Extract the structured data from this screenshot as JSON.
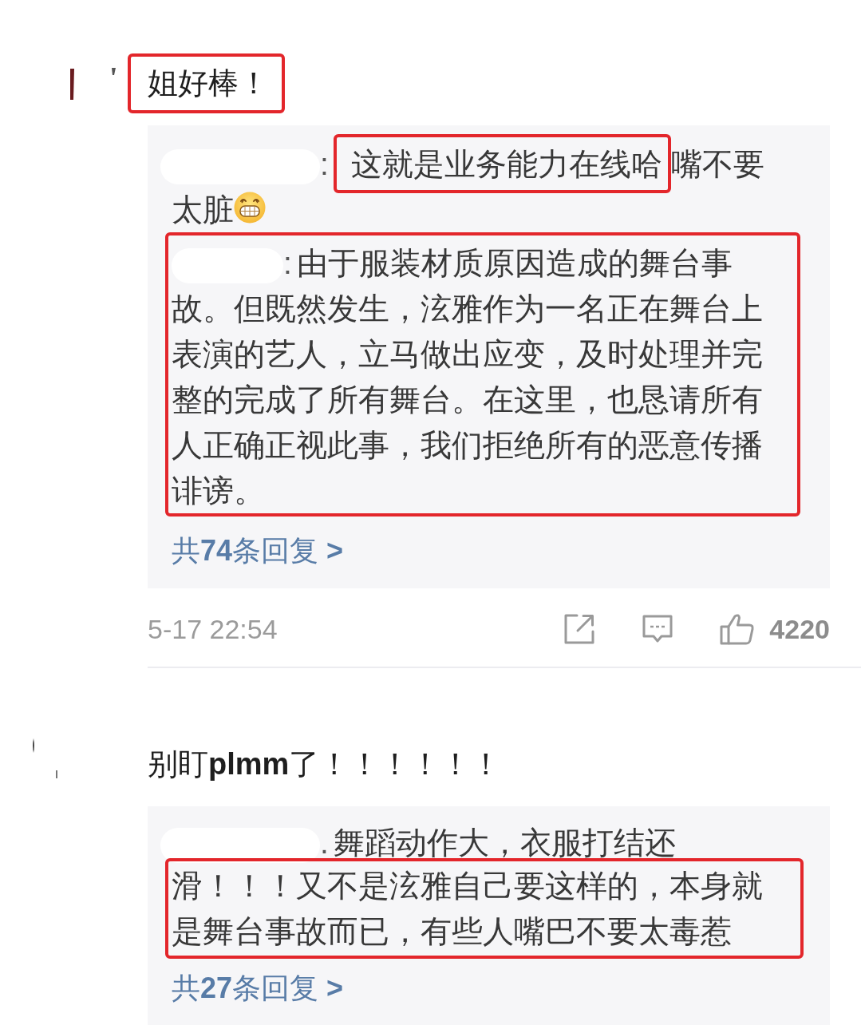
{
  "comments": [
    {
      "author_redacted": true,
      "text": "姐好棒！",
      "highlighted": true,
      "replies": [
        {
          "author_redacted": true,
          "separator": ":",
          "highlighted": false,
          "segments": [
            {
              "kind": "text",
              "text": "这就是业务能力在线哈",
              "highlighted": true
            },
            {
              "kind": "text",
              "text": "嘴不要太脏",
              "highlighted": false
            },
            {
              "kind": "emoji"
            }
          ]
        },
        {
          "author_redacted": true,
          "separator": ":",
          "highlighted": true,
          "segments": [
            {
              "kind": "text",
              "text": "由于服装材质原因造成的舞台事故。但既然发生，泫雅作为一名正在舞台上表演的艺人，立马做出应变，及时处理并完整的完成了所有舞台。在这里，也恳请所有人正确正视此事，我们拒绝所有的恶意传播诽谤。",
              "highlighted": false
            }
          ]
        }
      ],
      "reply_count_link": "共**74**条回复 **>**",
      "time": "5-17 22:54",
      "likes": "4220"
    },
    {
      "author_redacted": true,
      "text": "别盯**plmm**了！！！！！！",
      "highlighted": false,
      "replies": [
        {
          "author_redacted": true,
          "separator": ".",
          "highlighted": false,
          "segments": [
            {
              "kind": "text",
              "text": "舞蹈动作大，衣服打结还",
              "highlighted": false
            },
            {
              "kind": "text",
              "text": "滑！！！又不是泫雅自己要这样的，本身就是舞台事故而已，有些人嘴巴不要太毒惹",
              "highlighted": true
            }
          ]
        }
      ],
      "reply_count_link": "共**27**条回复 **>**"
    }
  ]
}
